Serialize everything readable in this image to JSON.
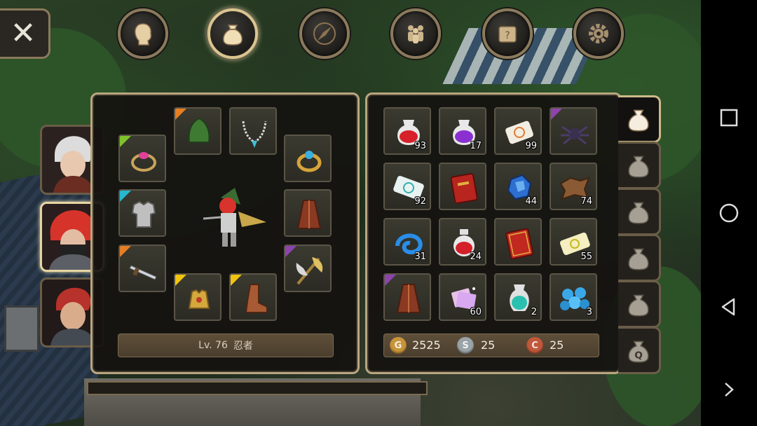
{
  "colors": {
    "frame_gold": "#b9a67f",
    "panel_bg": "#141210",
    "tag_orange": "#e67e22",
    "tag_green": "#7ec32a",
    "tag_cyan": "#26b8d0",
    "tag_purple": "#8e44ad",
    "tag_yellow": "#f1c40f",
    "gold_coin": "#c8943a",
    "silver_coin": "#9aa3a8",
    "copper_coin": "#c0583a"
  },
  "nav": {
    "items": [
      {
        "icon": "character-head-icon",
        "active": false
      },
      {
        "icon": "bag-icon",
        "active": true
      },
      {
        "icon": "skill-compass-icon",
        "active": false
      },
      {
        "icon": "party-icon",
        "active": false
      },
      {
        "icon": "quest-scroll-icon",
        "active": false
      },
      {
        "icon": "gear-icon",
        "active": false
      }
    ],
    "close_label": "✕"
  },
  "characters": [
    {
      "name": "white-haired-character",
      "active": false
    },
    {
      "name": "red-haired-masked-ninja",
      "active": true
    },
    {
      "name": "red-haired-warrior",
      "active": false
    }
  ],
  "equipment": {
    "level_label": "Lv. 76",
    "class_name": "忍者",
    "slots": [
      {
        "slot": "ring-left",
        "icon": "pink-gem-ring-icon",
        "tag": "green"
      },
      {
        "slot": "helmet",
        "icon": "green-hood-icon",
        "tag": "orange"
      },
      {
        "slot": "necklace",
        "icon": "silver-necklace-icon",
        "tag": ""
      },
      {
        "slot": "ring-right",
        "icon": "gold-ring-icon",
        "tag": ""
      },
      {
        "slot": "armor",
        "icon": "silver-armor-icon",
        "tag": "cyan"
      },
      {
        "slot": "cloak",
        "icon": "brown-cloak-icon",
        "tag": ""
      },
      {
        "slot": "weapon",
        "icon": "dagger-icon",
        "tag": "orange"
      },
      {
        "slot": "offhand",
        "icon": "golden-axe-icon",
        "tag": "purple"
      },
      {
        "slot": "gloves",
        "icon": "gold-gauntlet-icon",
        "tag": "yellow"
      },
      {
        "slot": "boots",
        "icon": "leather-boots-icon",
        "tag": "yellow"
      }
    ]
  },
  "inventory": {
    "items": [
      {
        "icon": "red-potion-icon",
        "qty": "93",
        "tag": ""
      },
      {
        "icon": "purple-potion-icon",
        "qty": "17",
        "tag": ""
      },
      {
        "icon": "orange-scroll-icon",
        "qty": "99",
        "tag": ""
      },
      {
        "icon": "dark-spider-icon",
        "qty": "",
        "tag": "purple"
      },
      {
        "icon": "teal-map-scroll-icon",
        "qty": "92",
        "tag": ""
      },
      {
        "icon": "red-book-icon",
        "qty": "",
        "tag": ""
      },
      {
        "icon": "blue-crystal-icon",
        "qty": "44",
        "tag": ""
      },
      {
        "icon": "leather-hide-icon",
        "qty": "74",
        "tag": ""
      },
      {
        "icon": "blue-swirl-icon",
        "qty": "31",
        "tag": ""
      },
      {
        "icon": "red-flask-icon",
        "qty": "24",
        "tag": ""
      },
      {
        "icon": "red-tome-icon",
        "qty": "",
        "tag": ""
      },
      {
        "icon": "yellow-scroll-icon",
        "qty": "55",
        "tag": ""
      },
      {
        "icon": "brown-robe-icon",
        "qty": "",
        "tag": "purple"
      },
      {
        "icon": "pink-crystal-cards-icon",
        "qty": "60",
        "tag": ""
      },
      {
        "icon": "teal-vase-icon",
        "qty": "2",
        "tag": ""
      },
      {
        "icon": "blue-orbs-icon",
        "qty": "3",
        "tag": ""
      }
    ]
  },
  "currency": {
    "gold": {
      "symbol": "G",
      "amount": "2525"
    },
    "silver": {
      "symbol": "S",
      "amount": "25"
    },
    "copper": {
      "symbol": "C",
      "amount": "25"
    }
  },
  "bag_tabs": [
    {
      "label": "",
      "active": true
    },
    {
      "label": "",
      "active": false
    },
    {
      "label": "",
      "active": false
    },
    {
      "label": "",
      "active": false
    },
    {
      "label": "",
      "active": false
    },
    {
      "label": "Q",
      "active": false
    }
  ]
}
